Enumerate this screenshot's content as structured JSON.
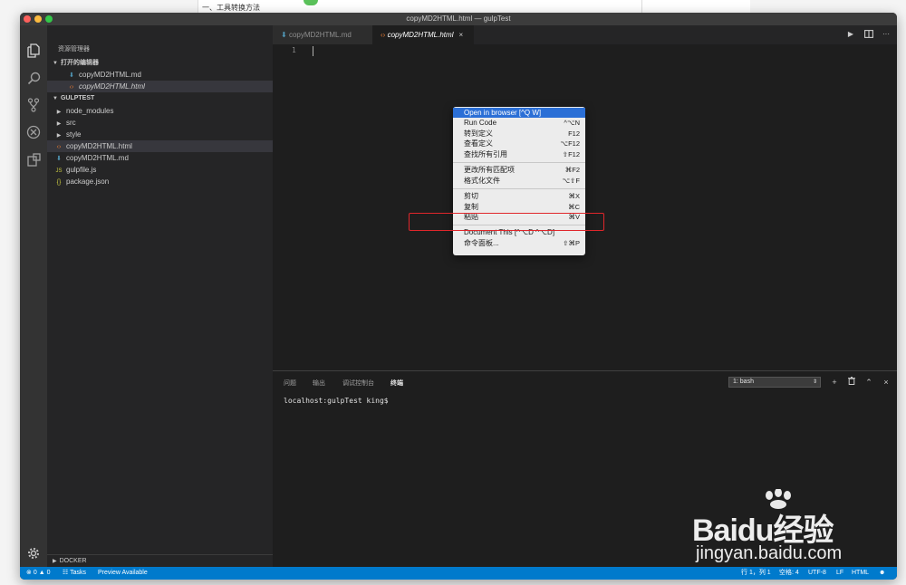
{
  "background": {
    "doc_snippet": "一、工具转换方法"
  },
  "window": {
    "title": "copyMD2HTML.html — gulpTest"
  },
  "activity_bar": [
    "files-icon",
    "search-icon",
    "git-icon",
    "debug-icon",
    "extensions-icon",
    "gear-icon"
  ],
  "sidebar": {
    "title": "资源管理器",
    "open_editors_label": "打开的编辑器",
    "open_editors": [
      {
        "name": "copyMD2HTML.md",
        "icon": "md-file-icon"
      },
      {
        "name": "copyMD2HTML.html",
        "icon": "html-file-icon"
      }
    ],
    "project_label": "GULPTEST",
    "tree": [
      {
        "name": "node_modules",
        "icon": "folder-caret"
      },
      {
        "name": "src",
        "icon": "folder-caret"
      },
      {
        "name": "style",
        "icon": "folder-caret"
      },
      {
        "name": "copyMD2HTML.html",
        "icon": "html-file-icon"
      },
      {
        "name": "copyMD2HTML.md",
        "icon": "md-file-icon"
      },
      {
        "name": "gulpfile.js",
        "icon": "js-file-icon"
      },
      {
        "name": "package.json",
        "icon": "json-file-icon"
      }
    ],
    "docker_label": "DOCKER"
  },
  "tabs": [
    {
      "label": "copyMD2HTML.md"
    },
    {
      "label": "copyMD2HTML.html",
      "close": "×"
    }
  ],
  "editor": {
    "line_number": "1"
  },
  "context_menu": {
    "groups": [
      [
        {
          "label": "Open in browser [^Q W]",
          "shortcut": ""
        },
        {
          "label": "Run Code",
          "shortcut": "^⌥N"
        },
        {
          "label": "转到定义",
          "shortcut": "F12"
        },
        {
          "label": "查看定义",
          "shortcut": "⌥F12"
        },
        {
          "label": "查找所有引用",
          "shortcut": "⇧F12"
        }
      ],
      [
        {
          "label": "更改所有匹配项",
          "shortcut": "⌘F2"
        },
        {
          "label": "格式化文件",
          "shortcut": "⌥⇧F"
        }
      ],
      [
        {
          "label": "剪切",
          "shortcut": "⌘X"
        },
        {
          "label": "复制",
          "shortcut": "⌘C"
        },
        {
          "label": "粘贴",
          "shortcut": "⌘V"
        }
      ],
      [
        {
          "label": "Document This [^⌥D ^⌥D]",
          "shortcut": ""
        },
        {
          "label": "命令面板...",
          "shortcut": "⇧⌘P"
        }
      ]
    ]
  },
  "panel": {
    "tabs": [
      "问题",
      "输出",
      "调试控制台",
      "终端"
    ],
    "active_tab": "终端",
    "terminal_select": "1: bash",
    "terminal_line": "localhost:gulpTest king$"
  },
  "status_bar": {
    "errors": "0",
    "warnings": "0",
    "tasks": "Tasks",
    "preview": "Preview Available",
    "position": "行 1，列 1",
    "spaces": "空格: 4",
    "encoding": "UTF-8",
    "eol": "LF",
    "language": "HTML"
  },
  "watermark": {
    "brand": "Baidu经验",
    "url": "jingyan.baidu.com"
  },
  "colors": {
    "accent": "#007acc",
    "menu_highlight": "#2b6fd6",
    "annotation_red": "#e0262b"
  }
}
